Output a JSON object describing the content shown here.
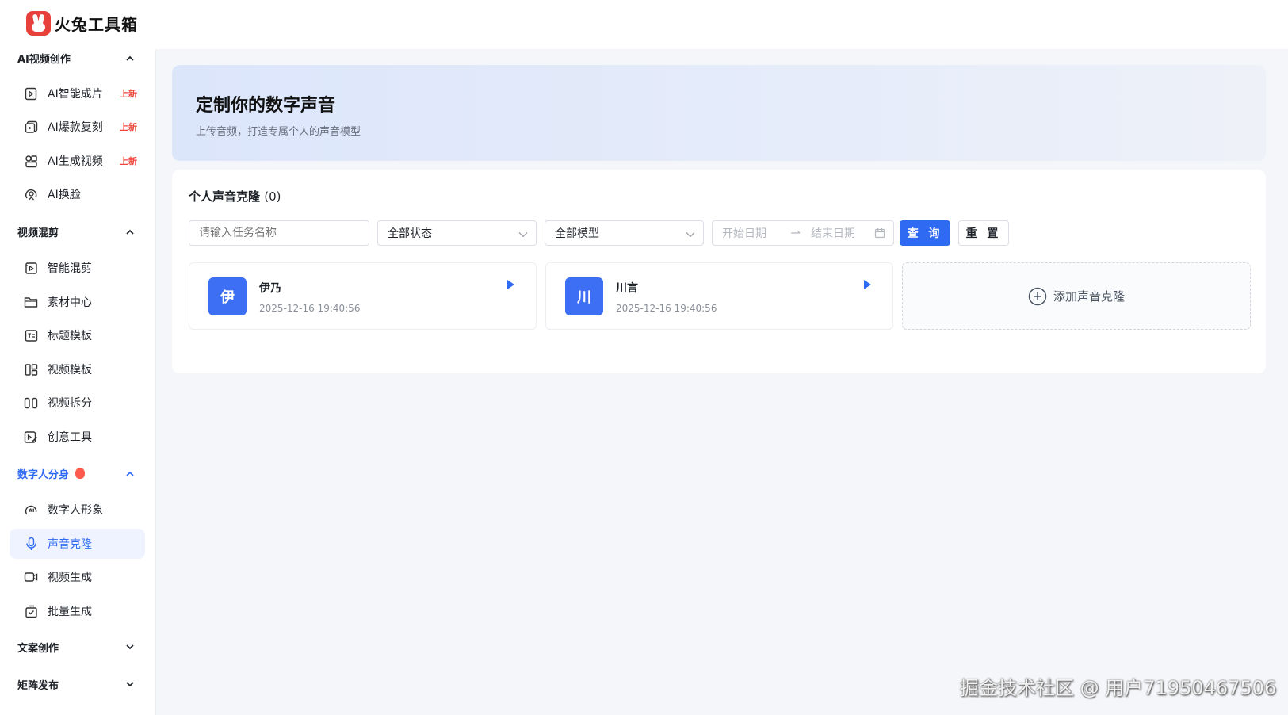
{
  "app": {
    "name": "火兔工具箱"
  },
  "sidebar": {
    "groups": [
      {
        "label": "AI视频创作",
        "expanded": true,
        "items": [
          {
            "label": "AI智能成片",
            "icon": "ai-video-icon",
            "badge": "上新"
          },
          {
            "label": "AI爆款复刻",
            "icon": "ai-copy-icon",
            "badge": "上新"
          },
          {
            "label": "AI生成视频",
            "icon": "ai-generate-icon",
            "badge": "上新"
          },
          {
            "label": "AI换脸",
            "icon": "face-swap-icon",
            "badge": ""
          }
        ]
      },
      {
        "label": "视频混剪",
        "expanded": true,
        "items": [
          {
            "label": "智能混剪",
            "icon": "smart-mix-icon"
          },
          {
            "label": "素材中心",
            "icon": "folder-icon"
          },
          {
            "label": "标题模板",
            "icon": "title-template-icon"
          },
          {
            "label": "视频模板",
            "icon": "video-template-icon"
          },
          {
            "label": "视频拆分",
            "icon": "split-icon"
          },
          {
            "label": "创意工具",
            "icon": "creative-tool-icon"
          }
        ]
      },
      {
        "label": "数字人分身",
        "expanded": true,
        "hot": true,
        "items": [
          {
            "label": "数字人形象",
            "icon": "digital-human-icon"
          },
          {
            "label": "声音克隆",
            "icon": "microphone-icon",
            "selected": true
          },
          {
            "label": "视频生成",
            "icon": "video-camera-icon"
          },
          {
            "label": "批量生成",
            "icon": "batch-icon"
          }
        ]
      },
      {
        "label": "文案创作",
        "expanded": false,
        "items": []
      },
      {
        "label": "矩阵发布",
        "expanded": false,
        "items": []
      }
    ]
  },
  "banner": {
    "title": "定制你的数字声音",
    "subtitle": "上传音频，打造专属个人的声音模型"
  },
  "panel": {
    "title": "个人声音克隆",
    "count": "(0)",
    "filters": {
      "task_placeholder": "请输入任务名称",
      "status_value": "全部状态",
      "model_value": "全部模型",
      "start_date_placeholder": "开始日期",
      "end_date_placeholder": "结束日期",
      "query_label": "查 询",
      "reset_label": "重 置"
    },
    "voices": [
      {
        "avatar": "伊",
        "name": "伊乃",
        "time": "2025-12-16 19:40:56"
      },
      {
        "avatar": "川",
        "name": "川言",
        "time": "2025-12-16 19:40:56"
      }
    ],
    "add_label": "添加声音克隆"
  },
  "colors": {
    "accent": "#2f6bf2",
    "badge": "#f04438",
    "avatar": "#3d6ff5"
  },
  "watermark": "掘金技术社区 @ 用户71950467506"
}
